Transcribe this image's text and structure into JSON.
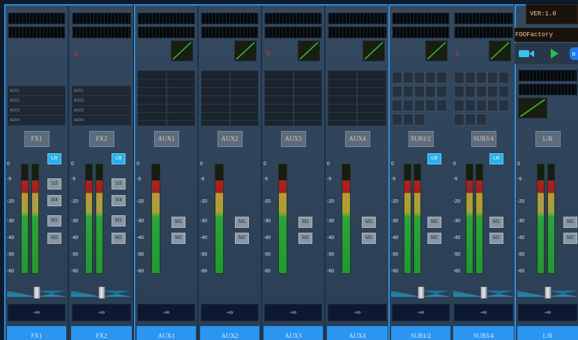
{
  "version_label": "VER:1.0",
  "preset_name": "FOOFactory",
  "meter_scale": [
    "0",
    "-5",
    "-20",
    "-30",
    "-40",
    "-50",
    "-60"
  ],
  "level_readout": "-∞",
  "assign_buttons": {
    "lr": "LR",
    "sub12": "1/2",
    "sub34": "3/4",
    "m1": "M1",
    "m2": "M2"
  },
  "fx_routing": [
    "AUX1",
    "AUX2",
    "AUX3",
    "AUX4"
  ],
  "channels": [
    {
      "name": "FX1",
      "badge": "FX1",
      "letter": "",
      "level": 0.85
    },
    {
      "name": "FX2",
      "badge": "FX2",
      "letter": "a",
      "level": 0.85
    },
    {
      "name": "AUX1",
      "badge": "AUX1",
      "letter": "",
      "level": 0.85
    },
    {
      "name": "AUX2",
      "badge": "AUX2",
      "letter": "",
      "level": 0.85
    },
    {
      "name": "AUX3",
      "badge": "AUX3",
      "letter": "b",
      "level": 0.85
    },
    {
      "name": "AUX4",
      "badge": "AUX4",
      "letter": "",
      "level": 0.85
    },
    {
      "name": "SUB1/2",
      "badge": "SUB1/2",
      "letter": "",
      "level": 0.85
    },
    {
      "name": "SUB3/4",
      "badge": "SUB3/4",
      "letter": "c",
      "level": 0.85
    },
    {
      "name": "L/R",
      "badge": "L/R",
      "letter": "",
      "level": 0.85
    }
  ],
  "colors": {
    "accent": "#2b95ef",
    "lr_active": "#2bb0ec",
    "version_text": "#ffc79a",
    "marker_letter": "#e0302a"
  }
}
